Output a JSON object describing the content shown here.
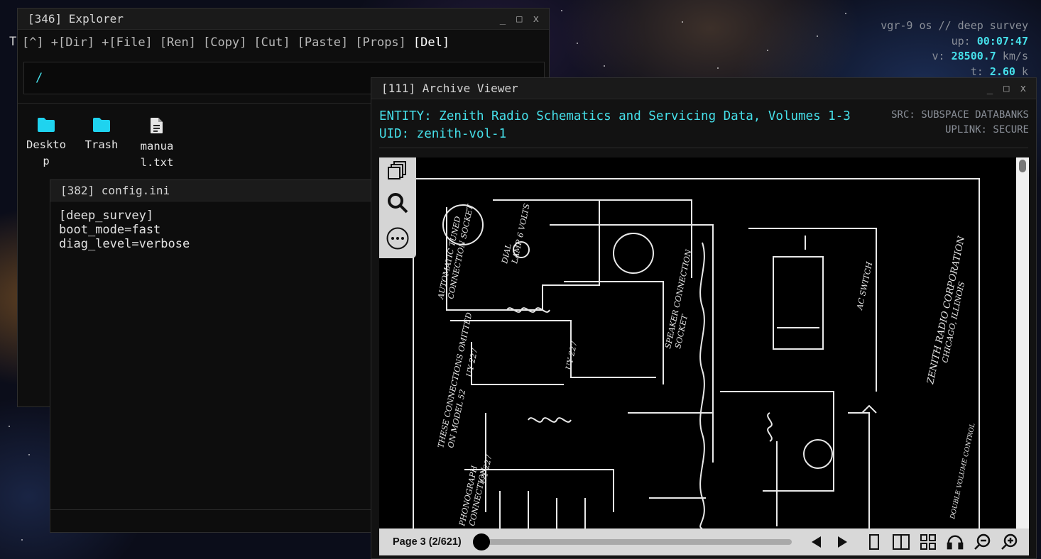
{
  "hud": {
    "os": "vgr-9 os // deep survey",
    "uptime_label": "up:",
    "uptime": "00:07:47",
    "velocity_label": "v:",
    "velocity": "28500.7",
    "velocity_unit": "km/s",
    "t_label": "t:",
    "t_value": "2.60",
    "t_unit": "k"
  },
  "explorer": {
    "title": "[346] Explorer",
    "ghost": "T",
    "toolbar": [
      "[^]",
      "+[Dir]",
      "+[File]",
      "[Ren]",
      "[Copy]",
      "[Cut]",
      "[Paste]",
      "[Props]",
      "[Del]"
    ],
    "path": "/",
    "items": [
      {
        "label_l1": "Deskto",
        "label_l2": "p",
        "icon": "folder-icon"
      },
      {
        "label_l1": "Trash",
        "label_l2": "",
        "icon": "folder-icon"
      },
      {
        "label_l1": "manua",
        "label_l2": "l.txt",
        "icon": "file-icon"
      }
    ]
  },
  "config": {
    "title": "[382] config.ini",
    "content": "[deep_survey]\nboot_mode=fast\ndiag_level=verbose"
  },
  "viewer": {
    "title": "[111] Archive Viewer",
    "entity": "ENTITY: Zenith Radio Schematics and Servicing Data, Volumes 1-3",
    "uid": "UID: zenith-vol-1",
    "src": "SRC: SUBSPACE DATABANKS",
    "uplink": "UPLINK: SECURE",
    "page_label": "Page 3 (2/621)",
    "progress": 0.003
  },
  "window_controls": {
    "minimize": "_",
    "maximize": "□",
    "close": "x"
  },
  "colors": {
    "accent": "#46e0ea",
    "window_bg": "#0c0c0c",
    "titlebar": "#1a1a1a"
  }
}
